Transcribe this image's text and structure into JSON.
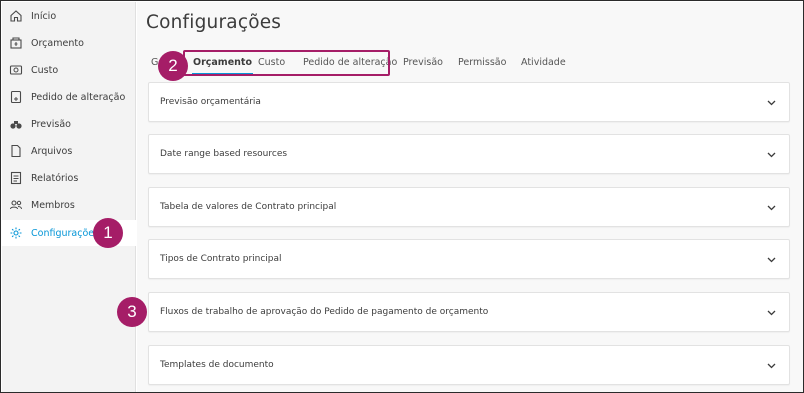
{
  "sidebar": {
    "items": [
      {
        "label": "Início",
        "icon": "home-icon"
      },
      {
        "label": "Orçamento",
        "icon": "budget-icon"
      },
      {
        "label": "Custo",
        "icon": "cost-icon"
      },
      {
        "label": "Pedido de alteração",
        "icon": "change-order-icon"
      },
      {
        "label": "Previsão",
        "icon": "binoculars-icon"
      },
      {
        "label": "Arquivos",
        "icon": "file-icon"
      },
      {
        "label": "Relatórios",
        "icon": "report-icon"
      },
      {
        "label": "Membros",
        "icon": "members-icon"
      },
      {
        "label": "Configurações",
        "icon": "gear-icon",
        "active": true
      }
    ]
  },
  "header": {
    "title": "Configurações"
  },
  "tabs": [
    {
      "label": "Ge"
    },
    {
      "label": "Orçamento",
      "active": true
    },
    {
      "label": "Custo"
    },
    {
      "label": "Pedido de alteração"
    },
    {
      "label": "Previsão"
    },
    {
      "label": "Permissão"
    },
    {
      "label": "Atividade"
    }
  ],
  "panels": [
    {
      "label": "Previsão orçamentária"
    },
    {
      "label": "Date range based resources"
    },
    {
      "label": "Tabela de valores de Contrato principal"
    },
    {
      "label": "Tipos de Contrato principal"
    },
    {
      "label": "Fluxos de trabalho de aprovação do Pedido de pagamento de orçamento"
    },
    {
      "label": "Templates de documento"
    }
  ],
  "callouts": [
    "1",
    "2",
    "3"
  ],
  "colors": {
    "accent": "#0696d7",
    "callout": "#a51d67",
    "sidebar_bg": "#f3f3f3",
    "main_bg": "#f8f8f8"
  }
}
